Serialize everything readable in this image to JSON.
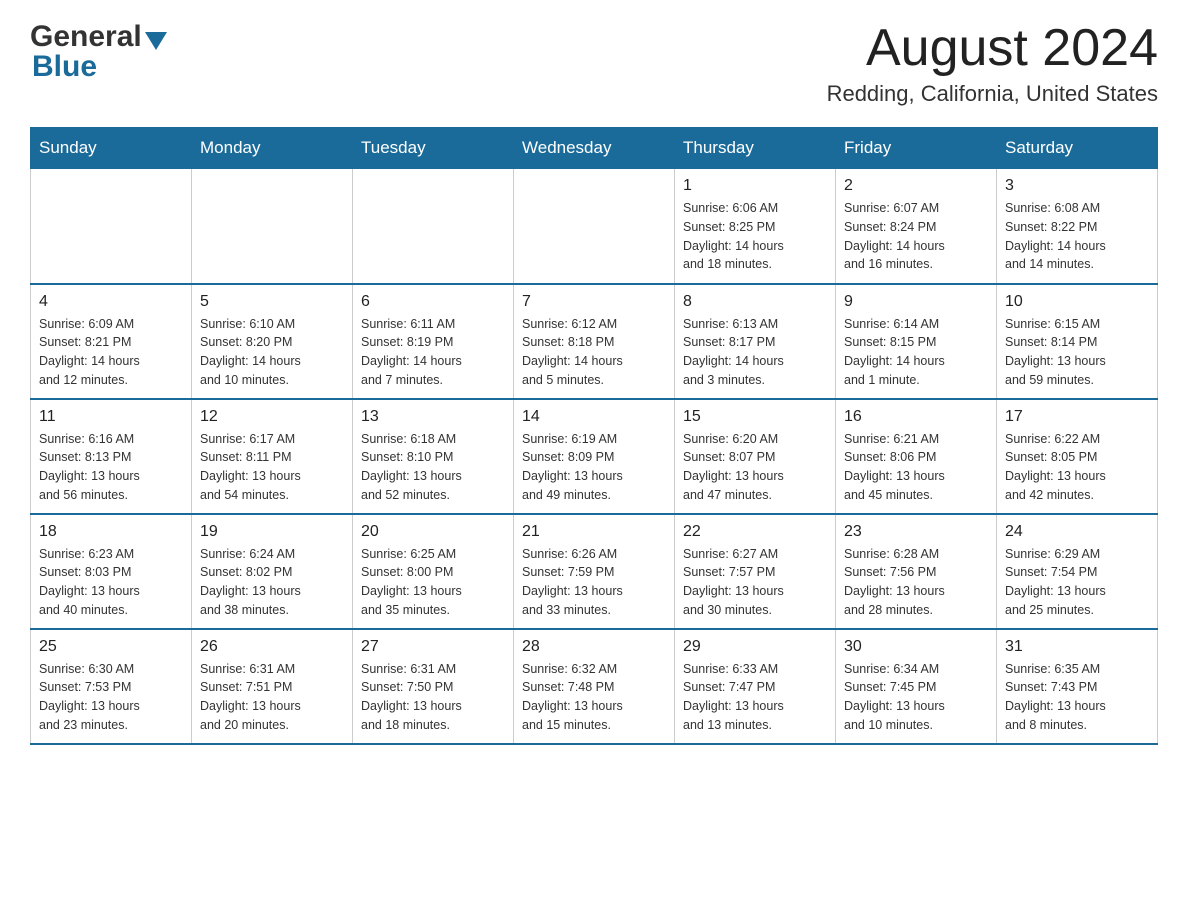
{
  "header": {
    "logo": {
      "general": "General",
      "triangle": "▲",
      "blue": "Blue"
    },
    "title": "August 2024",
    "location": "Redding, California, United States"
  },
  "days_of_week": [
    "Sunday",
    "Monday",
    "Tuesday",
    "Wednesday",
    "Thursday",
    "Friday",
    "Saturday"
  ],
  "weeks": [
    [
      {
        "day": "",
        "info": ""
      },
      {
        "day": "",
        "info": ""
      },
      {
        "day": "",
        "info": ""
      },
      {
        "day": "",
        "info": ""
      },
      {
        "day": "1",
        "info": "Sunrise: 6:06 AM\nSunset: 8:25 PM\nDaylight: 14 hours\nand 18 minutes."
      },
      {
        "day": "2",
        "info": "Sunrise: 6:07 AM\nSunset: 8:24 PM\nDaylight: 14 hours\nand 16 minutes."
      },
      {
        "day": "3",
        "info": "Sunrise: 6:08 AM\nSunset: 8:22 PM\nDaylight: 14 hours\nand 14 minutes."
      }
    ],
    [
      {
        "day": "4",
        "info": "Sunrise: 6:09 AM\nSunset: 8:21 PM\nDaylight: 14 hours\nand 12 minutes."
      },
      {
        "day": "5",
        "info": "Sunrise: 6:10 AM\nSunset: 8:20 PM\nDaylight: 14 hours\nand 10 minutes."
      },
      {
        "day": "6",
        "info": "Sunrise: 6:11 AM\nSunset: 8:19 PM\nDaylight: 14 hours\nand 7 minutes."
      },
      {
        "day": "7",
        "info": "Sunrise: 6:12 AM\nSunset: 8:18 PM\nDaylight: 14 hours\nand 5 minutes."
      },
      {
        "day": "8",
        "info": "Sunrise: 6:13 AM\nSunset: 8:17 PM\nDaylight: 14 hours\nand 3 minutes."
      },
      {
        "day": "9",
        "info": "Sunrise: 6:14 AM\nSunset: 8:15 PM\nDaylight: 14 hours\nand 1 minute."
      },
      {
        "day": "10",
        "info": "Sunrise: 6:15 AM\nSunset: 8:14 PM\nDaylight: 13 hours\nand 59 minutes."
      }
    ],
    [
      {
        "day": "11",
        "info": "Sunrise: 6:16 AM\nSunset: 8:13 PM\nDaylight: 13 hours\nand 56 minutes."
      },
      {
        "day": "12",
        "info": "Sunrise: 6:17 AM\nSunset: 8:11 PM\nDaylight: 13 hours\nand 54 minutes."
      },
      {
        "day": "13",
        "info": "Sunrise: 6:18 AM\nSunset: 8:10 PM\nDaylight: 13 hours\nand 52 minutes."
      },
      {
        "day": "14",
        "info": "Sunrise: 6:19 AM\nSunset: 8:09 PM\nDaylight: 13 hours\nand 49 minutes."
      },
      {
        "day": "15",
        "info": "Sunrise: 6:20 AM\nSunset: 8:07 PM\nDaylight: 13 hours\nand 47 minutes."
      },
      {
        "day": "16",
        "info": "Sunrise: 6:21 AM\nSunset: 8:06 PM\nDaylight: 13 hours\nand 45 minutes."
      },
      {
        "day": "17",
        "info": "Sunrise: 6:22 AM\nSunset: 8:05 PM\nDaylight: 13 hours\nand 42 minutes."
      }
    ],
    [
      {
        "day": "18",
        "info": "Sunrise: 6:23 AM\nSunset: 8:03 PM\nDaylight: 13 hours\nand 40 minutes."
      },
      {
        "day": "19",
        "info": "Sunrise: 6:24 AM\nSunset: 8:02 PM\nDaylight: 13 hours\nand 38 minutes."
      },
      {
        "day": "20",
        "info": "Sunrise: 6:25 AM\nSunset: 8:00 PM\nDaylight: 13 hours\nand 35 minutes."
      },
      {
        "day": "21",
        "info": "Sunrise: 6:26 AM\nSunset: 7:59 PM\nDaylight: 13 hours\nand 33 minutes."
      },
      {
        "day": "22",
        "info": "Sunrise: 6:27 AM\nSunset: 7:57 PM\nDaylight: 13 hours\nand 30 minutes."
      },
      {
        "day": "23",
        "info": "Sunrise: 6:28 AM\nSunset: 7:56 PM\nDaylight: 13 hours\nand 28 minutes."
      },
      {
        "day": "24",
        "info": "Sunrise: 6:29 AM\nSunset: 7:54 PM\nDaylight: 13 hours\nand 25 minutes."
      }
    ],
    [
      {
        "day": "25",
        "info": "Sunrise: 6:30 AM\nSunset: 7:53 PM\nDaylight: 13 hours\nand 23 minutes."
      },
      {
        "day": "26",
        "info": "Sunrise: 6:31 AM\nSunset: 7:51 PM\nDaylight: 13 hours\nand 20 minutes."
      },
      {
        "day": "27",
        "info": "Sunrise: 6:31 AM\nSunset: 7:50 PM\nDaylight: 13 hours\nand 18 minutes."
      },
      {
        "day": "28",
        "info": "Sunrise: 6:32 AM\nSunset: 7:48 PM\nDaylight: 13 hours\nand 15 minutes."
      },
      {
        "day": "29",
        "info": "Sunrise: 6:33 AM\nSunset: 7:47 PM\nDaylight: 13 hours\nand 13 minutes."
      },
      {
        "day": "30",
        "info": "Sunrise: 6:34 AM\nSunset: 7:45 PM\nDaylight: 13 hours\nand 10 minutes."
      },
      {
        "day": "31",
        "info": "Sunrise: 6:35 AM\nSunset: 7:43 PM\nDaylight: 13 hours\nand 8 minutes."
      }
    ]
  ]
}
